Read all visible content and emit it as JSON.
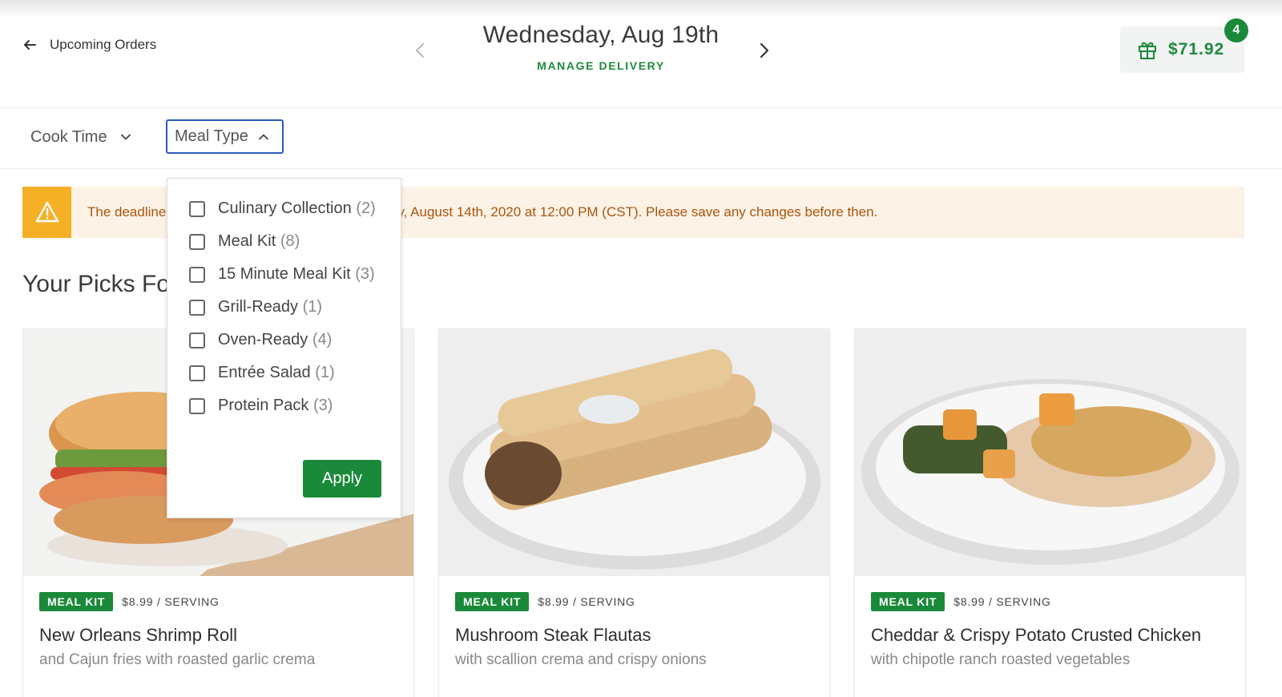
{
  "header": {
    "back_label": "Upcoming Orders",
    "date": "Wednesday, Aug 19th",
    "manage_delivery": "MANAGE DELIVERY",
    "cart_total": "$71.92",
    "cart_count": "4"
  },
  "filters": {
    "cook_time": "Cook Time",
    "meal_type": "Meal Type"
  },
  "meal_type_dropdown": {
    "options": [
      {
        "label": "Culinary Collection",
        "count": "(2)"
      },
      {
        "label": "Meal Kit",
        "count": "(8)"
      },
      {
        "label": "15 Minute Meal Kit",
        "count": "(3)"
      },
      {
        "label": "Grill-Ready",
        "count": "(1)"
      },
      {
        "label": "Oven-Ready",
        "count": "(4)"
      },
      {
        "label": "Entrée Salad",
        "count": "(1)"
      },
      {
        "label": "Protein Pack",
        "count": "(3)"
      }
    ],
    "apply_label": "Apply"
  },
  "alert": {
    "text": "The deadline to make changes to this order is Friday, August 14th, 2020 at 12:00 PM (CST). Please save any changes before then."
  },
  "section_title": "Your Picks For This Week",
  "cards": [
    {
      "tag": "MEAL KIT",
      "price": "$8.99 / SERVING",
      "title": "New Orleans Shrimp Roll",
      "subtitle": "and Cajun fries with roasted garlic crema"
    },
    {
      "tag": "MEAL KIT",
      "price": "$8.99 / SERVING",
      "title": "Mushroom Steak Flautas",
      "subtitle": "with scallion crema and crispy onions"
    },
    {
      "tag": "MEAL KIT",
      "price": "$8.99 / SERVING",
      "title": "Cheddar & Crispy Potato Crusted Chicken",
      "subtitle": "with chipotle ranch roasted vegetables"
    }
  ],
  "colors": {
    "brand_green": "#1a8a3a",
    "alert_bg": "#fdf2e6",
    "alert_icon": "#f5b026",
    "focus_border": "#2a5bb8"
  }
}
